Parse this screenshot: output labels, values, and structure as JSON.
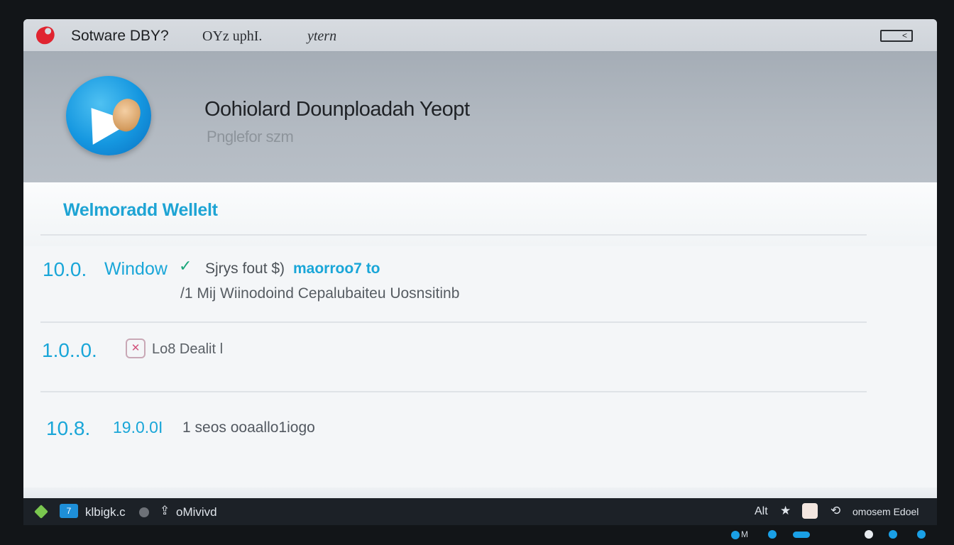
{
  "titlebar": {
    "title": "Sotware DBY?",
    "menu_1": "OYz uphI.",
    "menu_2": "ytern",
    "window_button_glyph": "<"
  },
  "header": {
    "title": "Oohiolard Dounploadah Yeopt",
    "subtitle": "Pnglefor szm"
  },
  "section": {
    "title": "Welmoradd Wellelt"
  },
  "rows": [
    {
      "version": "10.0.",
      "label": "Window",
      "text_a": "Sjrys fout $)",
      "text_b": "maorroo7 to",
      "line2": "/1 Mij Wiinodoind Cepalubaiteu Uosnsitinb"
    },
    {
      "version": "1.0..0.",
      "icon": "delete-icon",
      "text": "Lo8  Dealit l"
    },
    {
      "version": "10.8.",
      "number": "19.0.0I",
      "text": "1 seos ooaallo1iogo"
    }
  ],
  "taskbar": {
    "app_icon_glyph": "7",
    "item_1": "klbigk.c",
    "upload_glyph": "⇪",
    "item_2": "oMivivd",
    "alt_label": "Alt",
    "star_glyph": "★",
    "sync_glyph": "⟲",
    "clock": "omosem Edoel"
  },
  "tray": {
    "label": "M"
  },
  "colors": {
    "accent": "#19a6d8",
    "header_bg": "#a5adb6",
    "taskbar_bg": "#1c2127"
  }
}
